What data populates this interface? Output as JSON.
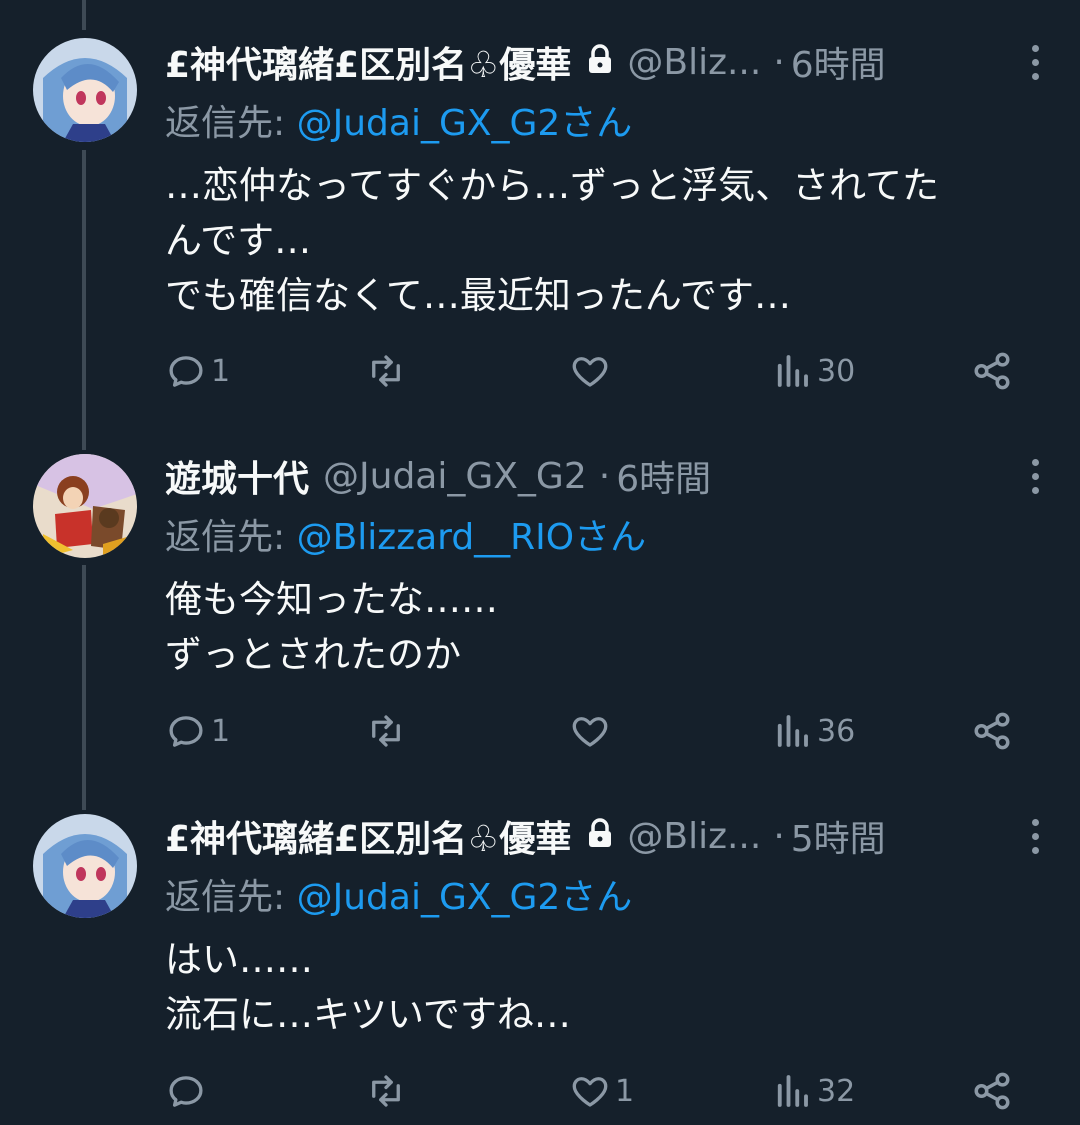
{
  "tweets": [
    {
      "name": "£神代璃緒£区別名♧優華",
      "handle": "@Bliz...",
      "dot": "·",
      "time": "6時間",
      "reply_prefix": "返信先:",
      "reply_mention": "@Judai_GX_G2さん",
      "text": "…恋仲なってすぐから…ずっと浮気、されてた\nんです…\nでも確信なくて…最近知ったんです…",
      "stats": {
        "reply": "1",
        "retweet": "",
        "like": "",
        "views": "30"
      }
    },
    {
      "name": "遊城十代",
      "handle": "@Judai_GX_G2",
      "dot": "·",
      "time": "6時間",
      "reply_prefix": "返信先:",
      "reply_mention": "@Blizzard__RIOさん",
      "text": "俺も今知ったな……\nずっとされたのか",
      "stats": {
        "reply": "1",
        "retweet": "",
        "like": "",
        "views": "36"
      }
    },
    {
      "name": "£神代璃緒£区別名♧優華",
      "handle": "@Bliz...",
      "dot": "·",
      "time": "5時間",
      "reply_prefix": "返信先:",
      "reply_mention": "@Judai_GX_G2さん",
      "text": "はい……\n流石に…キツいですね…",
      "stats": {
        "reply": "",
        "retweet": "",
        "like": "1",
        "views": "32"
      }
    }
  ],
  "icons": {
    "reply": "reply-icon",
    "retweet": "retweet-icon",
    "like": "heart-icon",
    "views": "views-icon",
    "share": "share-icon",
    "lock": "lock-icon",
    "more": "more-icon"
  },
  "colors": {
    "background": "#15202b",
    "text": "#f7f9f9",
    "secondary": "#8b98a5",
    "link": "#1d9bf0"
  }
}
